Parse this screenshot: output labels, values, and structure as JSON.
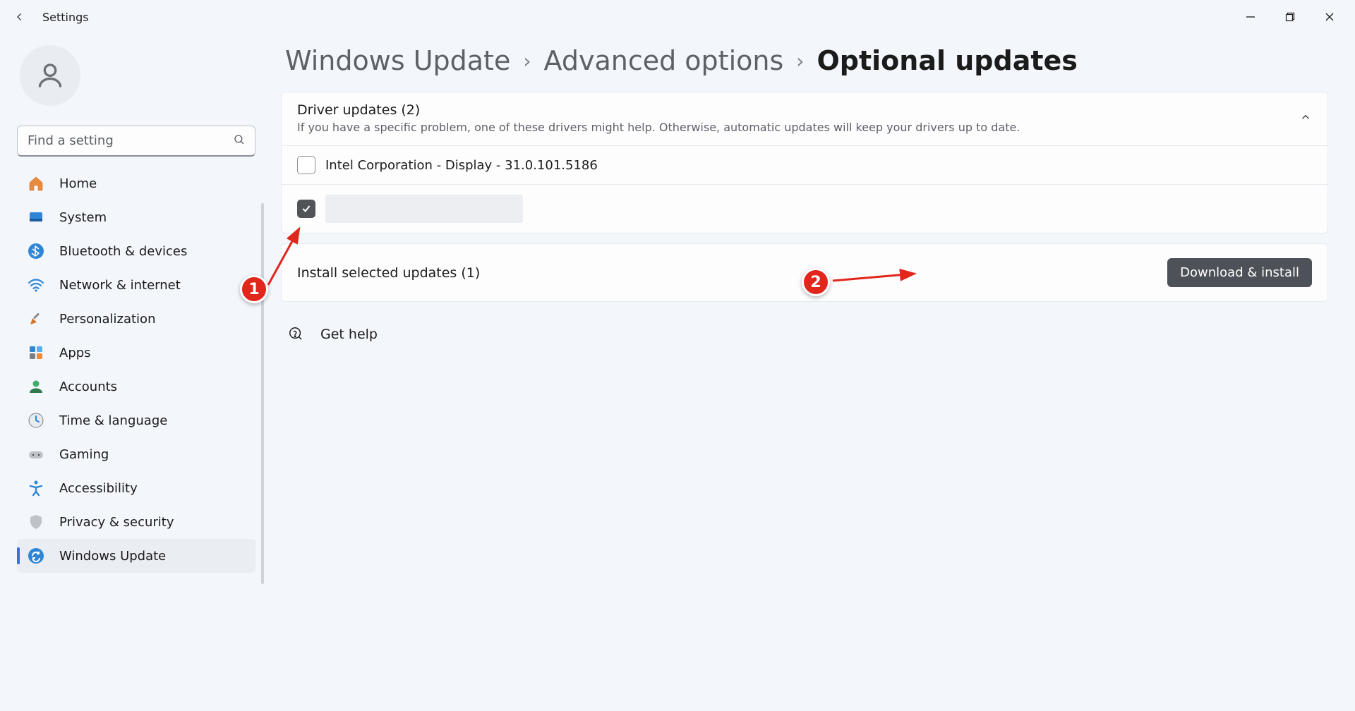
{
  "window": {
    "title": "Settings"
  },
  "search": {
    "placeholder": "Find a setting"
  },
  "sidebar": {
    "items": [
      {
        "label": "Home"
      },
      {
        "label": "System"
      },
      {
        "label": "Bluetooth & devices"
      },
      {
        "label": "Network & internet"
      },
      {
        "label": "Personalization"
      },
      {
        "label": "Apps"
      },
      {
        "label": "Accounts"
      },
      {
        "label": "Time & language"
      },
      {
        "label": "Gaming"
      },
      {
        "label": "Accessibility"
      },
      {
        "label": "Privacy & security"
      },
      {
        "label": "Windows Update"
      }
    ]
  },
  "breadcrumb": {
    "level1": "Windows Update",
    "level2": "Advanced options",
    "current": "Optional updates"
  },
  "driver_section": {
    "title": "Driver updates (2)",
    "description": "If you have a specific problem, one of these drivers might help. Otherwise, automatic updates will keep your drivers up to date.",
    "updates": [
      {
        "label": "Intel Corporation - Display - 31.0.101.5186",
        "checked": false
      },
      {
        "label": "",
        "checked": true,
        "redacted": true
      }
    ]
  },
  "install": {
    "label": "Install selected updates (1)",
    "button": "Download & install"
  },
  "help": {
    "label": "Get help"
  },
  "annotations": {
    "badge1": "1",
    "badge2": "2"
  }
}
